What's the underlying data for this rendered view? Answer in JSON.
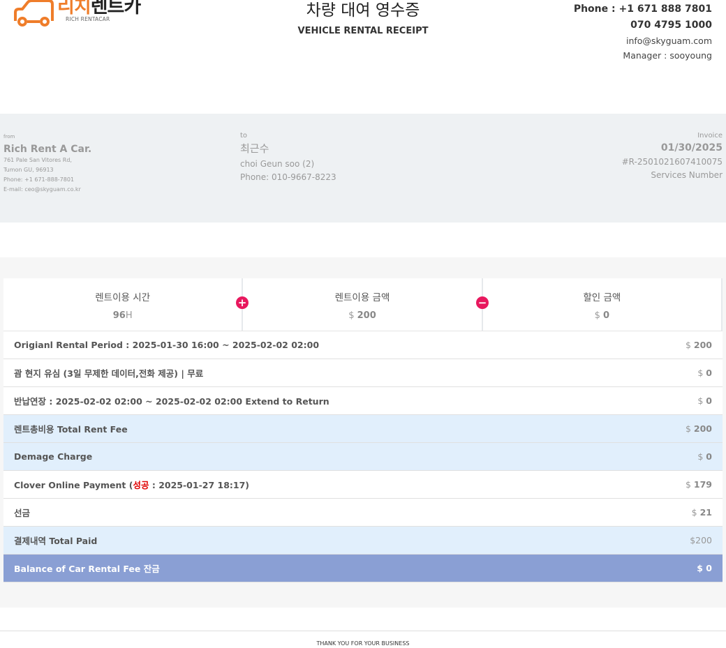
{
  "logo": {
    "main": "리치렌트카",
    "main_orange": "리치",
    "main_dark": "렌트카",
    "sub": "RICH RENTACAR"
  },
  "title": {
    "ko": "차량 대여 영수증",
    "en": "VEHICLE RENTAL RECEIPT"
  },
  "contact": {
    "phone1": "Phone : +1 671 888 7801",
    "phone2": "070 4795 1000",
    "email": "info@skyguam.com",
    "manager": "Manager : sooyoung"
  },
  "from": {
    "label": "from",
    "name": "Rich Rent A Car.",
    "addr1": "761 Pale San Vitores Rd,",
    "addr2": "Tumon GU, 96913",
    "phone": "Phone: +1 671-888-7801",
    "email": "E-mail: ceo@skyguam.co.kr"
  },
  "to": {
    "label": "to",
    "name": "최근수",
    "name_en": "choi Geun soo (2)",
    "phone": "Phone: 010-9667-8223"
  },
  "invoice": {
    "label": "Invoice",
    "date": "01/30/2025",
    "number": "#R-2501021607410075",
    "services": "Services Number"
  },
  "summary": {
    "time_label": "렌트이용 시간",
    "time_value": "96",
    "time_unit": "H",
    "amount_label": "렌트이용 금액",
    "amount_currency": "$ ",
    "amount_value": "200",
    "discount_label": "할인 금액",
    "discount_currency": "$ ",
    "discount_value": "0",
    "plus_symbol": "+",
    "minus_symbol": "−"
  },
  "rows": [
    {
      "label": "Origianl Rental Period : 2025-01-30 16:00 ~ 2025-02-02 02:00",
      "currency": "$ ",
      "amount": "200"
    },
    {
      "label": "괌 현지 유심 (3일 무제한 데이터,전화 제공) | 무료",
      "currency": "$ ",
      "amount": "0"
    },
    {
      "label": "반납연장 : 2025-02-02 02:00 ~ 2025-02-02 02:00 Extend to Return",
      "currency": "$ ",
      "amount": "0"
    },
    {
      "label": "렌트총비용 Total Rent Fee",
      "currency": "$ ",
      "amount": "200"
    },
    {
      "label": "Demage Charge",
      "currency": "$ ",
      "amount": "0"
    },
    {
      "label_pre": "Clover Online Payment (",
      "label_status": "성공",
      "label_post": " : 2025-01-27 18:17)",
      "currency": "$ ",
      "amount": "179"
    },
    {
      "label": "선금",
      "currency": "$ ",
      "amount": "21"
    },
    {
      "label": "결제내역 Total Paid",
      "amount_text": "$200"
    },
    {
      "label": "Balance of Car Rental Fee 잔금",
      "amount_text": "$ 0"
    }
  ],
  "footer": "THANK YOU FOR YOUR BUSINESS",
  "colors": {
    "brand": "#ef7d2a",
    "accent_pink": "#e8185e",
    "row_blue": "#e1effc",
    "balance": "#8a9fd4",
    "status_red": "#e00000"
  }
}
